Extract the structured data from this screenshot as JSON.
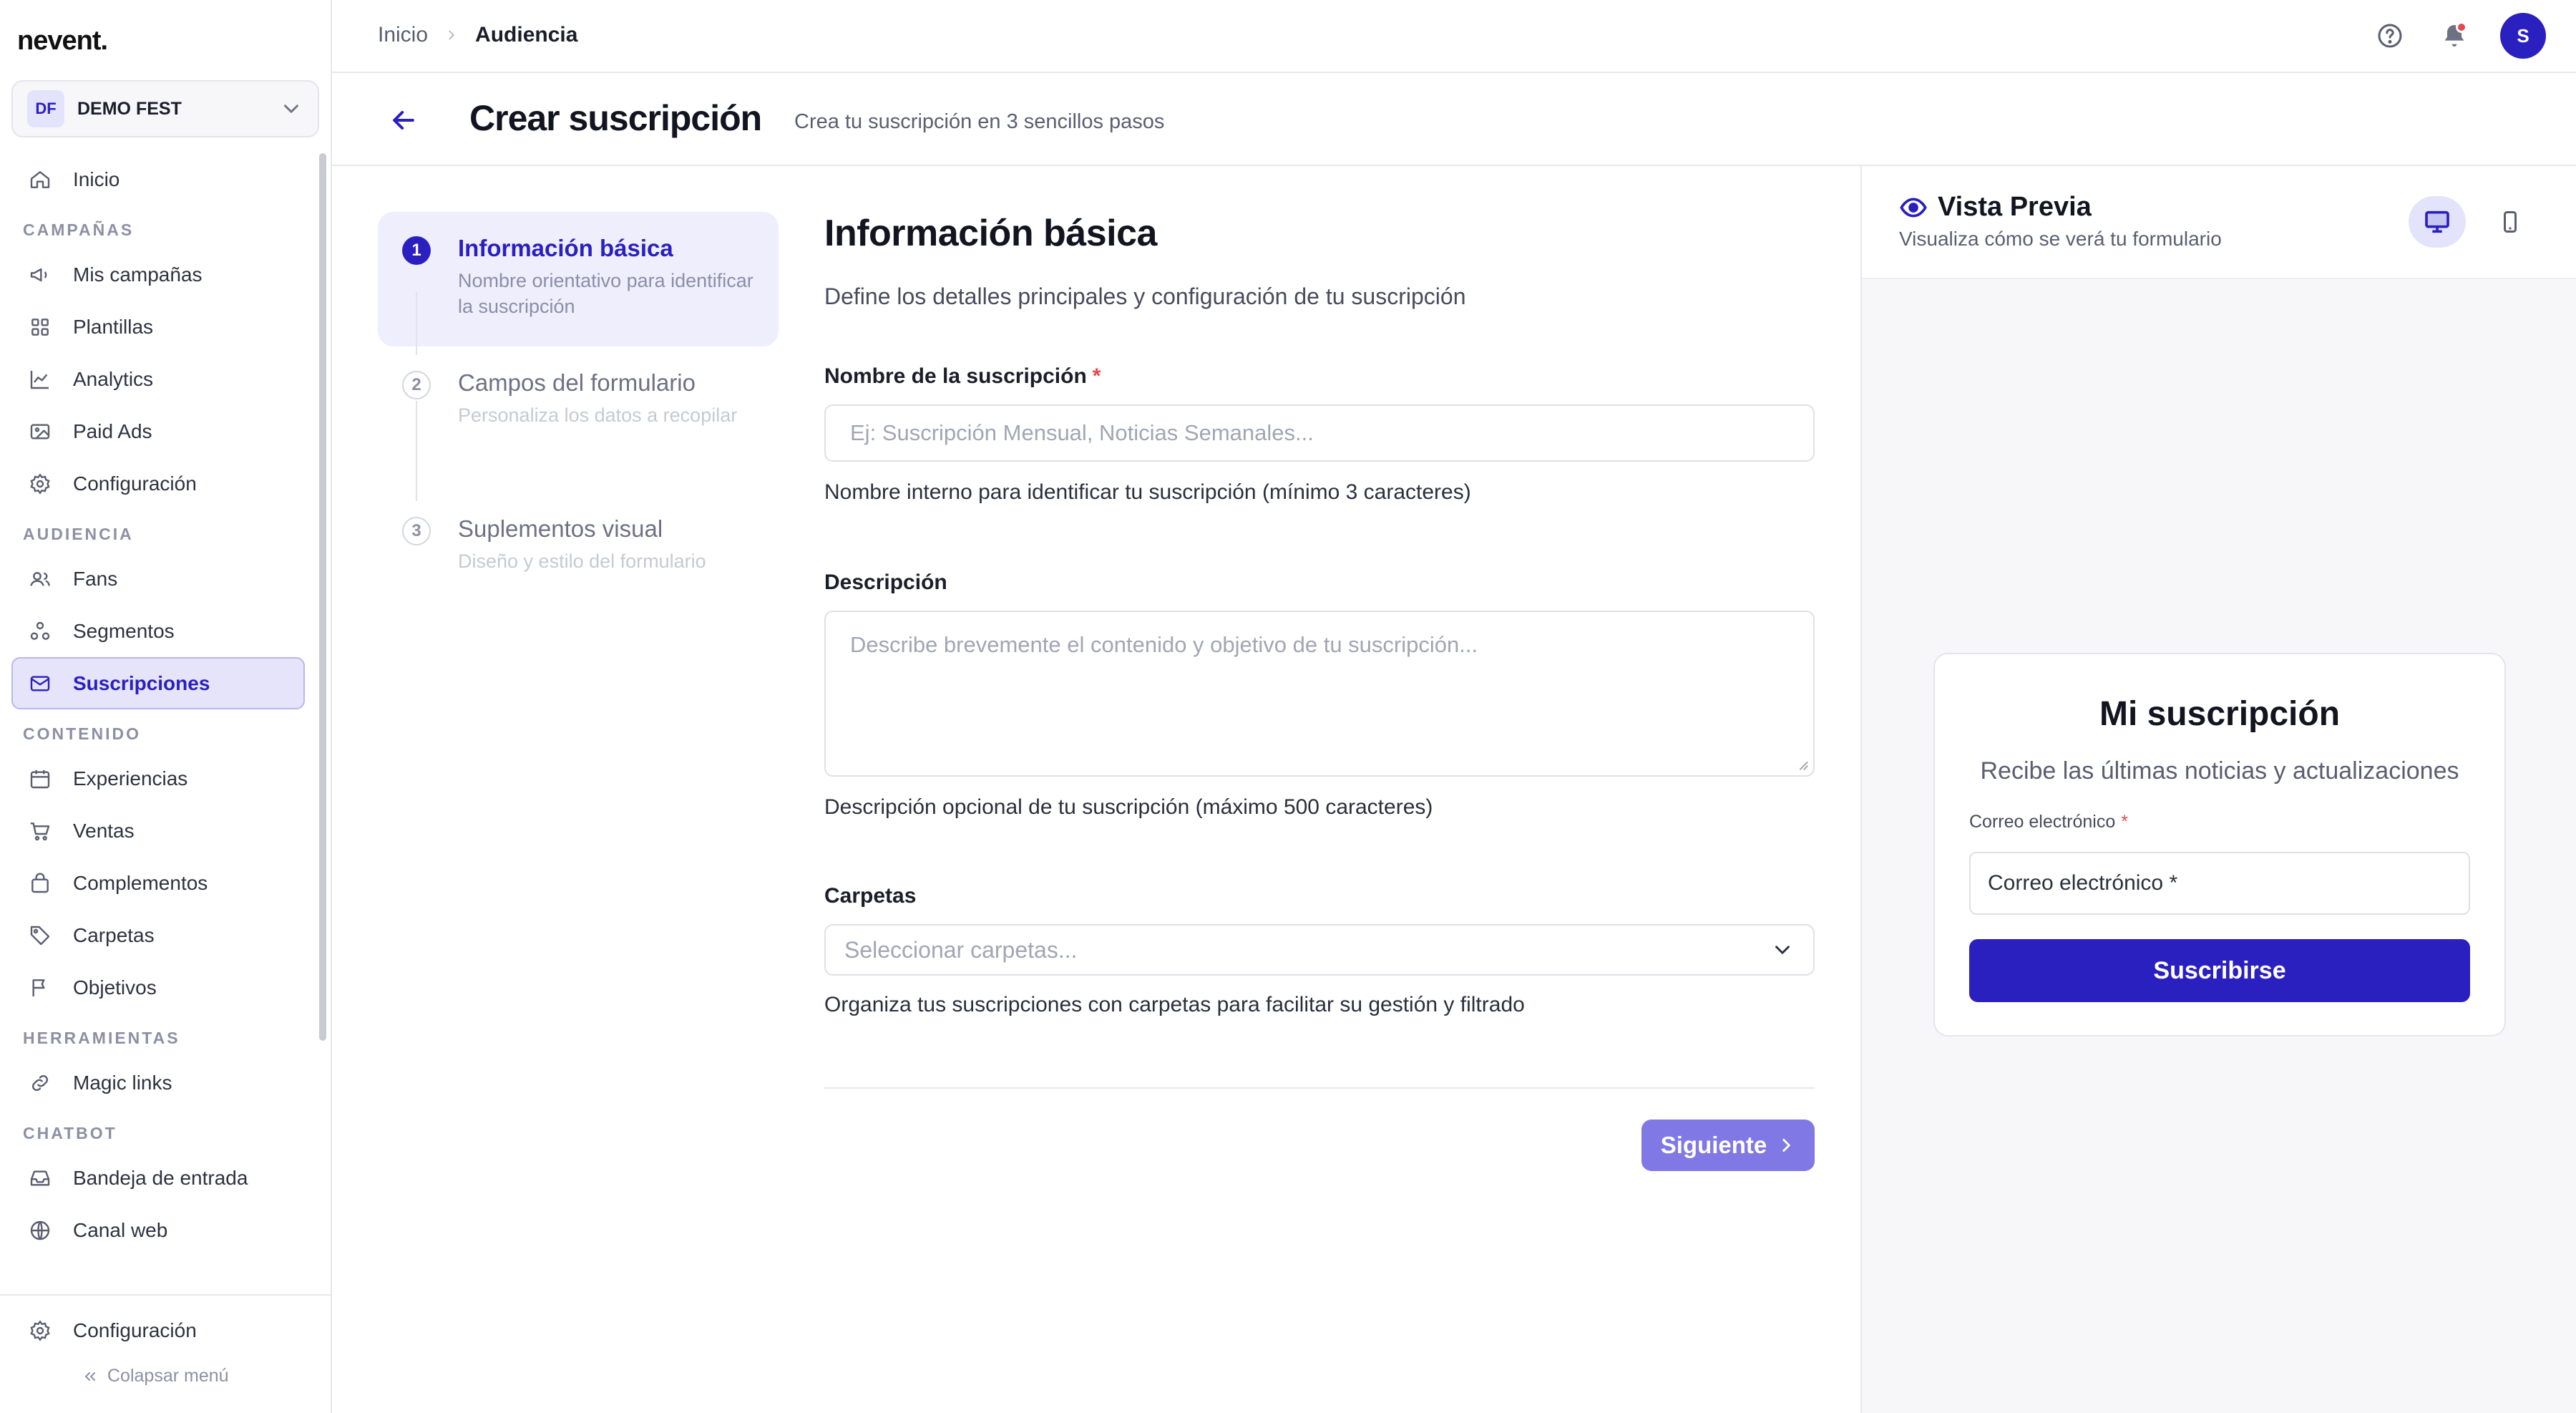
{
  "app": {
    "logo": "nevent."
  },
  "org": {
    "initials": "DF",
    "name": "DEMO FEST"
  },
  "sidebar": {
    "home": "Inicio",
    "sections": [
      {
        "title": "CAMPAÑAS",
        "items": [
          "Mis campañas",
          "Plantillas",
          "Analytics",
          "Paid Ads",
          "Configuración"
        ]
      },
      {
        "title": "AUDIENCIA",
        "items": [
          "Fans",
          "Segmentos",
          "Suscripciones"
        ]
      },
      {
        "title": "CONTENIDO",
        "items": [
          "Experiencias",
          "Ventas",
          "Complementos",
          "Carpetas",
          "Objetivos"
        ]
      },
      {
        "title": "HERRAMIENTAS",
        "items": [
          "Magic links"
        ]
      },
      {
        "title": "CHATBOT",
        "items": [
          "Bandeja de entrada",
          "Canal web"
        ]
      }
    ],
    "active_item": "Suscripciones",
    "settings": "Configuración",
    "collapse": "Colapsar menú"
  },
  "breadcrumb": {
    "home": "Inicio",
    "current": "Audiencia"
  },
  "user": {
    "initial": "S"
  },
  "page": {
    "title": "Crear suscripción",
    "subtitle": "Crea tu suscripción en 3 sencillos pasos"
  },
  "steps": [
    {
      "num": "1",
      "title": "Información básica",
      "desc": "Nombre orientativo para identificar la suscripción",
      "state": "active"
    },
    {
      "num": "2",
      "title": "Campos del formulario",
      "desc": "Personaliza los datos a recopilar",
      "state": "todo"
    },
    {
      "num": "3",
      "title": "Suplementos visual",
      "desc": "Diseño y estilo del formulario",
      "state": "todo"
    }
  ],
  "form": {
    "title": "Información básica",
    "subtitle": "Define los detalles principales y configuración de tu suscripción",
    "name_label": "Nombre de la suscripción",
    "required_mark": "*",
    "name_placeholder": "Ej: Suscripción Mensual, Noticias Semanales...",
    "name_help": "Nombre interno para identificar tu suscripción (mínimo 3 caracteres)",
    "desc_label": "Descripción",
    "desc_placeholder": "Describe brevemente el contenido y objetivo de tu suscripción...",
    "desc_help": "Descripción opcional de tu suscripción (máximo 500 caracteres)",
    "folders_label": "Carpetas",
    "folders_placeholder": "Seleccionar carpetas...",
    "folders_help": "Organiza tus suscripciones con carpetas para facilitar su gestión y filtrado",
    "next": "Siguiente"
  },
  "preview": {
    "title": "Vista Previa",
    "subtitle": "Visualiza cómo se verá tu formulario",
    "card_title": "Mi suscripción",
    "card_subtitle": "Recibe las últimas noticias y actualizaciones",
    "email_label": "Correo electrónico",
    "email_placeholder": "Correo electrónico *",
    "submit": "Suscribirse"
  },
  "colors": {
    "accent": "#2a1fbf",
    "accent_soft": "#e5e4fb",
    "next_button": "#8078e4",
    "required": "#e5484d"
  }
}
